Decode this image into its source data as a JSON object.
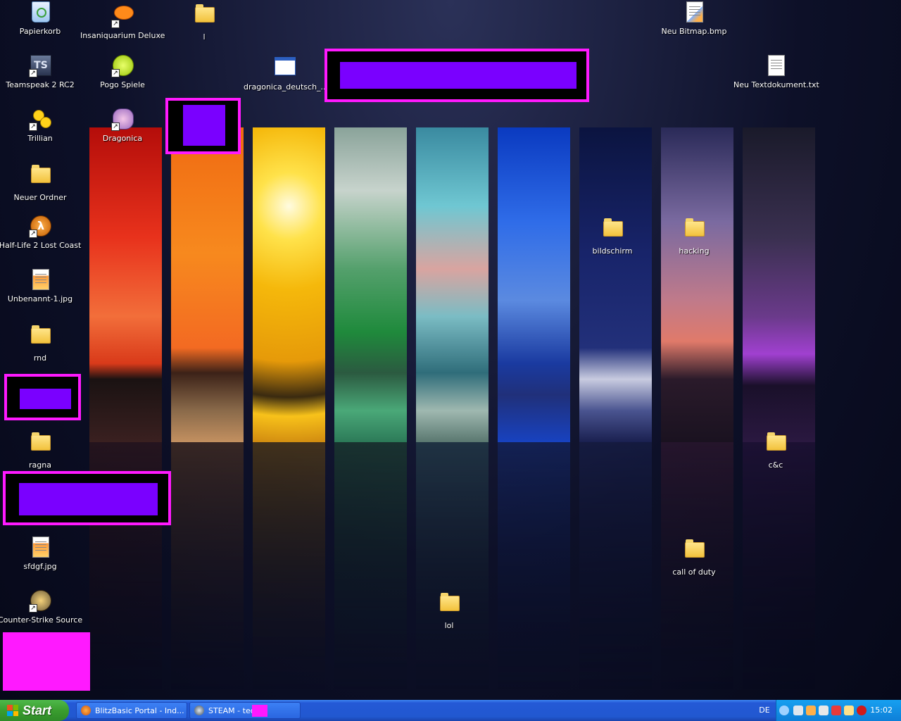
{
  "desktop": {
    "icons": [
      {
        "label": "Papierkorb"
      },
      {
        "label": "Insaniquarium Deluxe"
      },
      {
        "label": "l"
      },
      {
        "label": "Neu Bitmap.bmp"
      },
      {
        "label": "Teamspeak 2 RC2"
      },
      {
        "label": "Pogo Spiele"
      },
      {
        "label": "dragonica_deutsch_..."
      },
      {
        "label": "Neu Textdokument.txt"
      },
      {
        "label": "Trillian"
      },
      {
        "label": "Dragonica"
      },
      {
        "label": "Neuer Ordner"
      },
      {
        "label": "Half-Life 2 Lost Coast"
      },
      {
        "label": "bildschirm"
      },
      {
        "label": "hacking"
      },
      {
        "label": "Unbenannt-1.jpg"
      },
      {
        "label": "rnd"
      },
      {
        "label": "ragna"
      },
      {
        "label": "c&c"
      },
      {
        "label": "call of duty"
      },
      {
        "label": "sfdgf.jpg"
      },
      {
        "label": "lol"
      },
      {
        "label": "Counter-Strike Source"
      }
    ]
  },
  "taskbar": {
    "start_label": "Start",
    "tasks": [
      {
        "label": "BlitzBasic Portal - Ind..."
      },
      {
        "label": "STEAM - ted"
      }
    ],
    "language": "DE",
    "clock": "15:02"
  },
  "colors": {
    "taskbar": "#2459d6",
    "start_button": "#3a9d2f",
    "redaction_border": "#ff19ff",
    "redaction_fill": "#7a00ff"
  }
}
